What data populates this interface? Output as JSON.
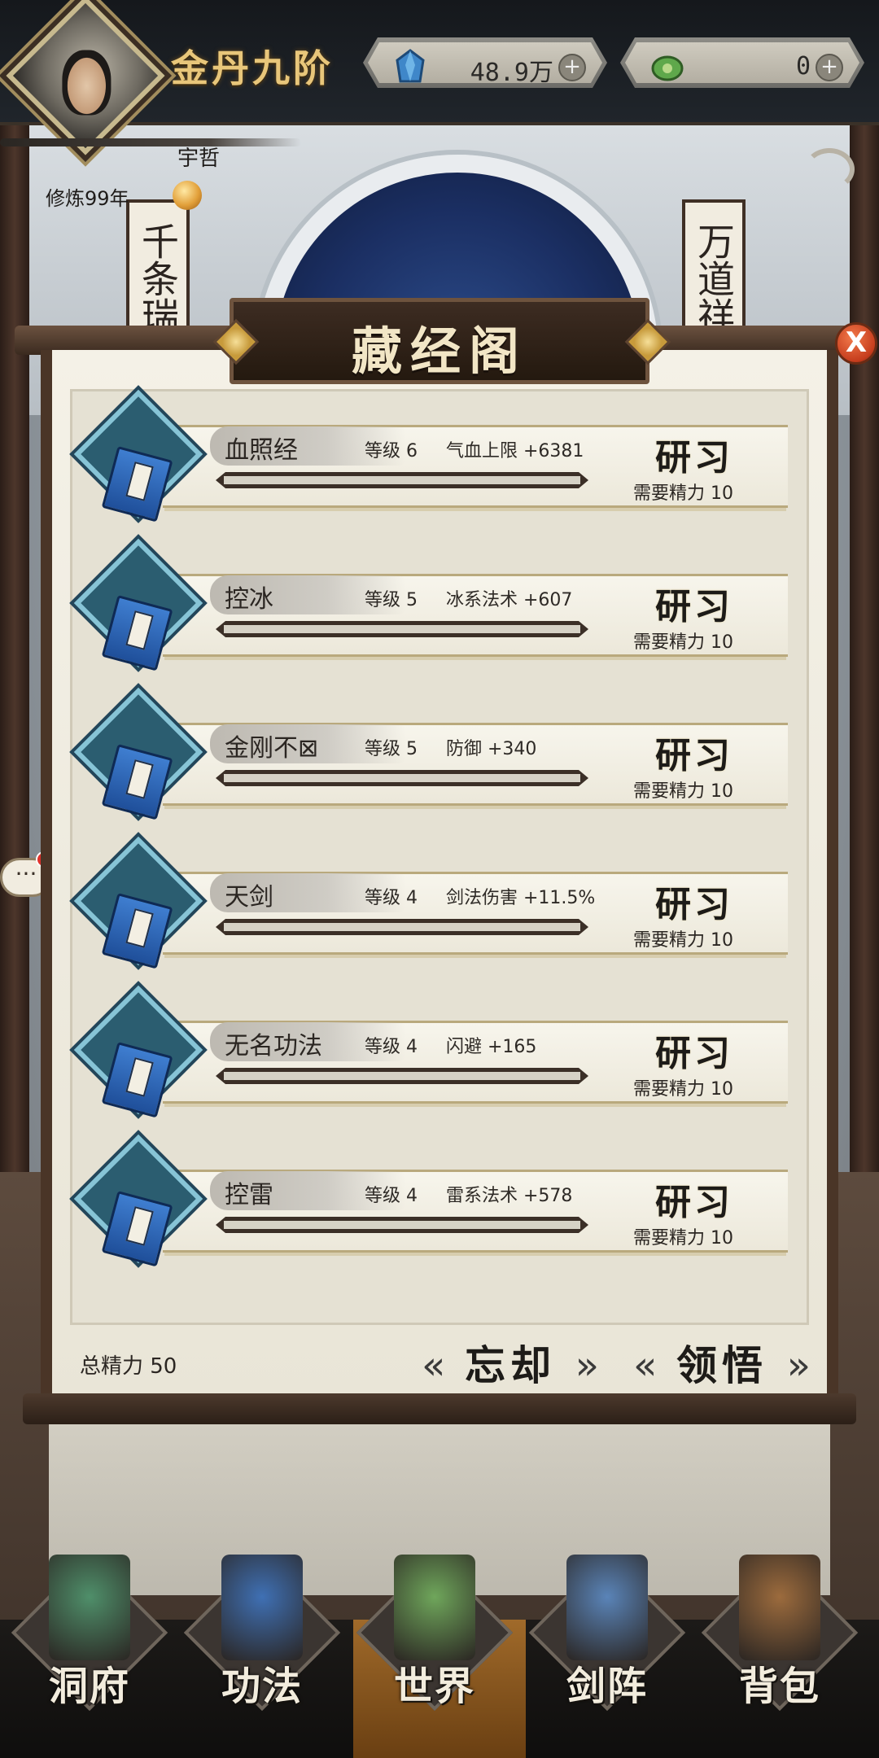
{
  "header": {
    "realm": "金丹九阶",
    "player_name": "宇哲",
    "cultivation": "修炼99年",
    "spirit_stones": "48.9万",
    "jade": "0"
  },
  "scene": {
    "left_scroll": "千条瑞",
    "right_scroll": "万道祥"
  },
  "panel": {
    "title": "藏经阁",
    "close": "X",
    "skills": [
      {
        "name": "血照经",
        "level": "等级 6",
        "attr": "气血上限 +6381",
        "button": "研习",
        "cost": "需要精力 10"
      },
      {
        "name": "控冰",
        "level": "等级 5",
        "attr": "冰系法术 +607",
        "button": "研习",
        "cost": "需要精力 10"
      },
      {
        "name": "金刚不⊠",
        "level": "等级 5",
        "attr": "防御 +340",
        "button": "研习",
        "cost": "需要精力 10"
      },
      {
        "name": "天剑",
        "level": "等级 4",
        "attr": "剑法伤害 +11.5%",
        "button": "研习",
        "cost": "需要精力 10"
      },
      {
        "name": "无名功法",
        "level": "等级 4",
        "attr": "闪避 +165",
        "button": "研习",
        "cost": "需要精力 10"
      },
      {
        "name": "控雷",
        "level": "等级 4",
        "attr": "雷系法术 +578",
        "button": "研习",
        "cost": "需要精力 10"
      }
    ],
    "total_energy": "总精力 50",
    "forget_button": "忘却",
    "comprehend_button": "领悟"
  },
  "chat": {
    "icon": "chat-bubble-icon",
    "text": "···"
  },
  "nav": {
    "items": [
      {
        "label": "洞府",
        "icon": "cave-mansion-icon"
      },
      {
        "label": "功法",
        "icon": "technique-book-icon"
      },
      {
        "label": "世界",
        "icon": "world-map-icon"
      },
      {
        "label": "剑阵",
        "icon": "sword-formation-icon"
      },
      {
        "label": "背包",
        "icon": "backpack-icon"
      }
    ],
    "active": "世界"
  },
  "colors": {
    "accent_gold": "#e8c67a",
    "panel_paper": "#f4f1e7",
    "book_frame": "#2b5d70",
    "close_red": "#c63d1d"
  }
}
